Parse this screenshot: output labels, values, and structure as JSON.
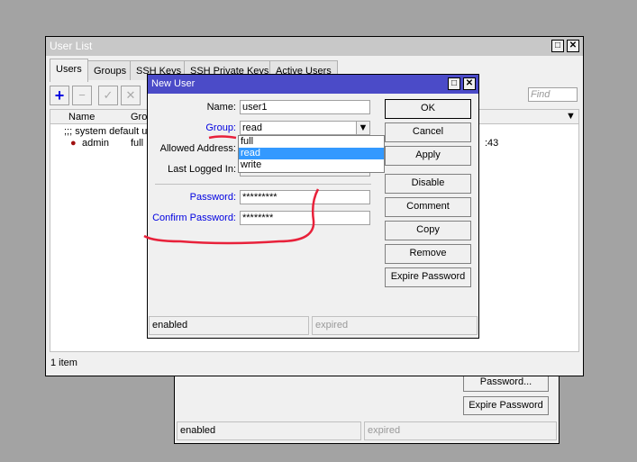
{
  "back_window": {
    "buttons": [
      "Password...",
      "Expire Password"
    ],
    "status": [
      "enabled",
      "expired"
    ]
  },
  "user_list": {
    "title": "User List",
    "tabs": [
      "Users",
      "Groups",
      "SSH Keys",
      "SSH Private Keys",
      "Active Users"
    ],
    "find_placeholder": "Find",
    "columns": [
      "Name",
      "Group"
    ],
    "rows": [
      {
        "comment": ";;; system default user"
      },
      {
        "name": "admin",
        "group": "full",
        "last": ":43"
      }
    ],
    "status": "1 item"
  },
  "dialog": {
    "title": "New User",
    "labels": {
      "name": "Name:",
      "group": "Group:",
      "allowed": "Allowed Address:",
      "last": "Last Logged In:",
      "password": "Password:",
      "confirm": "Confirm Password:"
    },
    "values": {
      "name": "user1",
      "group": "read",
      "password": "*********",
      "confirm": "********"
    },
    "group_options": [
      "full",
      "read",
      "write"
    ],
    "selected_option": "read",
    "buttons": [
      "OK",
      "Cancel",
      "Apply",
      "Disable",
      "Comment",
      "Copy",
      "Remove",
      "Expire Password"
    ],
    "status": [
      "enabled",
      "expired"
    ]
  },
  "colors": {
    "titlebar": "#4b4bc8",
    "selection": "#3399ff",
    "annotation": "#e8213a",
    "link_label": "#0000e0"
  }
}
